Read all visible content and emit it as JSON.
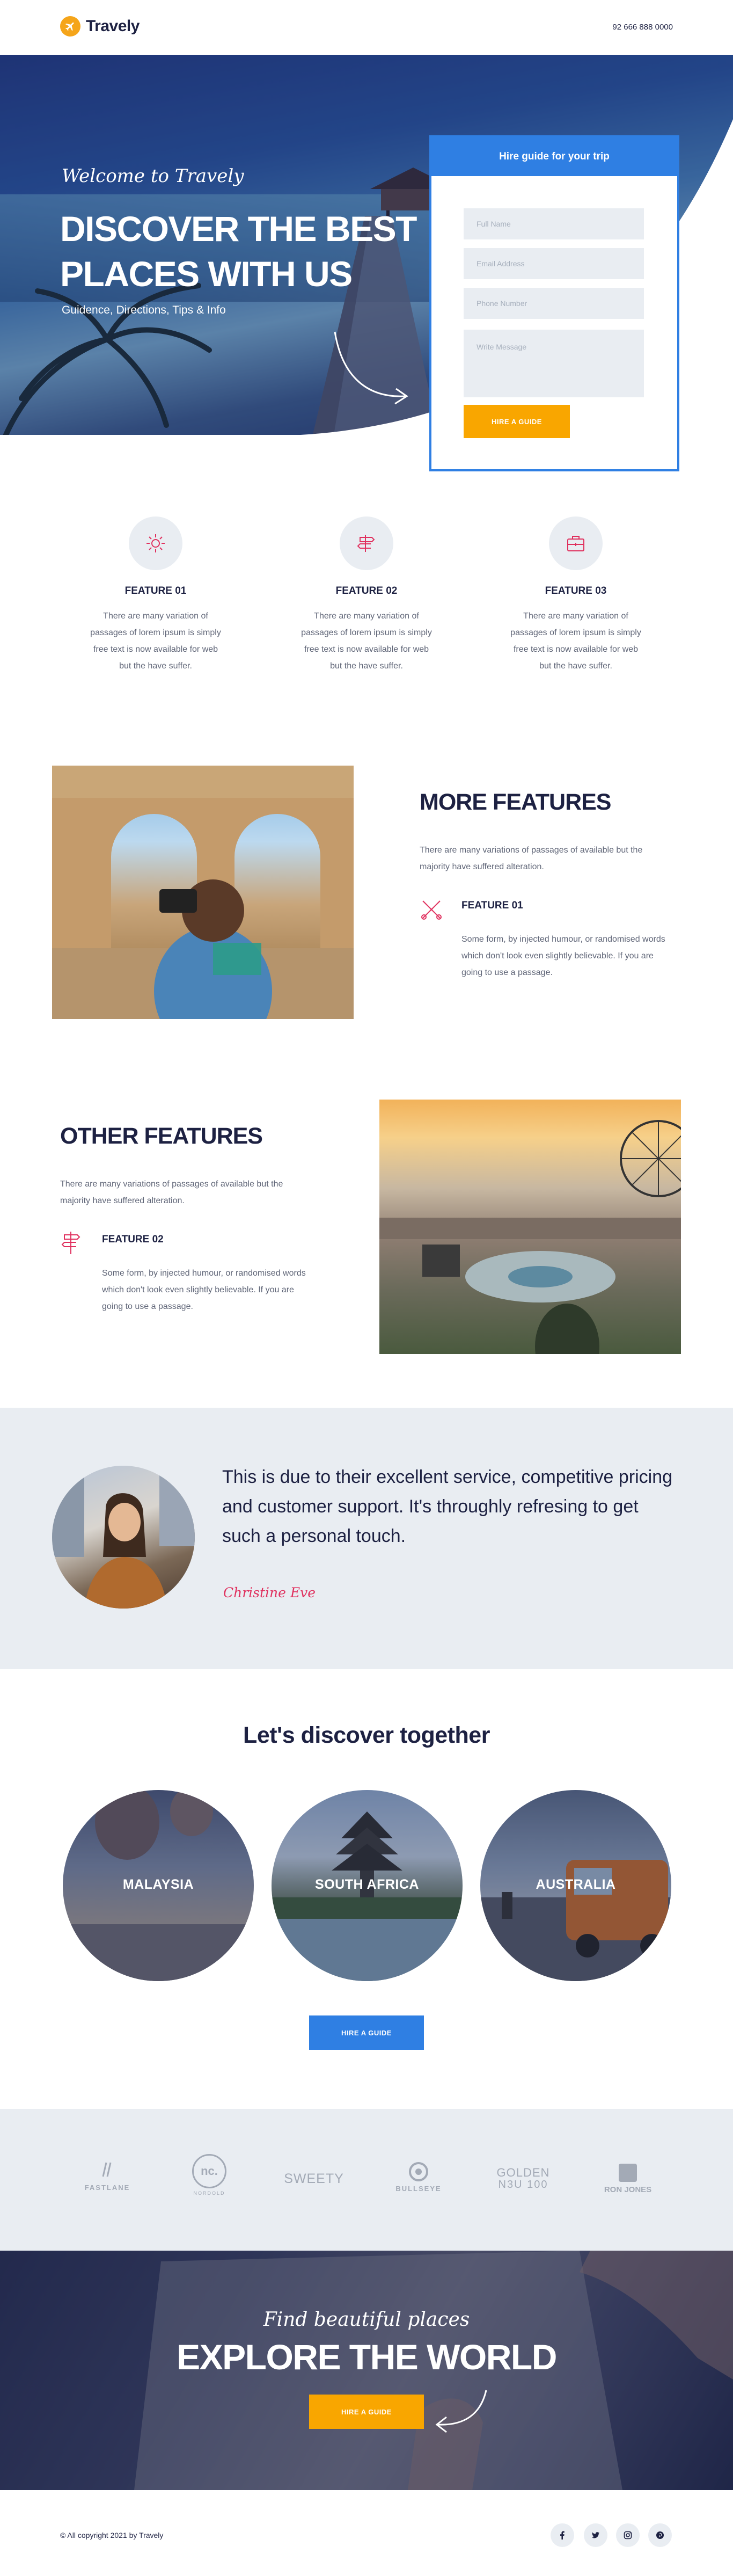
{
  "header": {
    "brand": "Travely",
    "phone": "92 666 888 0000"
  },
  "hero": {
    "welcome": "Welcome to Travely",
    "title": "DISCOVER THE BEST PLACES WITH US",
    "subtitle": "Guidence, Directions, Tips & Info"
  },
  "form": {
    "title": "Hire guide for your trip",
    "full_name_placeholder": "Full Name",
    "email_placeholder": "Email Address",
    "phone_placeholder": "Phone Number",
    "message_placeholder": "Write Message",
    "submit_label": "HIRE A GUIDE"
  },
  "features": [
    {
      "icon": "sun-icon",
      "title": "FEATURE 01",
      "text": "There are many variation of passages of lorem ipsum is simply free text is now available for web but the have suffer."
    },
    {
      "icon": "signpost-icon",
      "title": "FEATURE 02",
      "text": "There are many variation of passages of lorem ipsum is simply free text is now available for web but the have suffer."
    },
    {
      "icon": "suitcase-icon",
      "title": "FEATURE 03",
      "text": "There are many variation of passages of lorem ipsum is simply free text is now available for web but the have suffer."
    }
  ],
  "more_features": {
    "title": "MORE FEATURES",
    "text": "There are many variations of passages of available but the majority have suffered alteration.",
    "item_title": "FEATURE 01",
    "item_text": "Some form, by injected humour, or randomised words which don't look even slightly believable. If you are going to use a passage."
  },
  "other_features": {
    "title": "OTHER FEATURES",
    "text": "There are many variations of passages of available but the majority have suffered alteration.",
    "item_title": "FEATURE 02",
    "item_text": "Some form, by injected humour, or randomised words which don't look even slightly believable. If you are going to use a passage."
  },
  "testimonial": {
    "quote": "This is due to their excellent service, competitive pricing and customer support. It's throughly refresing to get such a personal touch.",
    "author": "Christine Eve"
  },
  "discover": {
    "title": "Let's discover together",
    "destinations": [
      "MALAYSIA",
      "SOUTH AFRICA",
      "AUSTRALIA"
    ],
    "button_label": "HIRE A GUIDE"
  },
  "brands": {
    "fastlane": "FASTLANE",
    "nc": "nc.",
    "nc_sub": "NORDOLD",
    "sweety": "SWEETY",
    "bullseye": "BULLSEYE",
    "golden_top": "GOLDEN",
    "golden_bottom": "N3U 100",
    "ronjones": "RON JONES"
  },
  "cta": {
    "find": "Find beautiful places",
    "title": "EXPLORE THE WORLD",
    "button_label": "HIRE A GUIDE"
  },
  "footer": {
    "copyright": "© All copyright 2021 by Travely",
    "social": [
      "facebook-icon",
      "twitter-icon",
      "instagram-icon",
      "pinterest-icon"
    ]
  },
  "colors": {
    "primary_blue": "#2f7fe3",
    "accent_yellow": "#f9a600",
    "navy": "#1d2142",
    "pink": "#e0305e",
    "light_gray": "#e9edf2"
  }
}
